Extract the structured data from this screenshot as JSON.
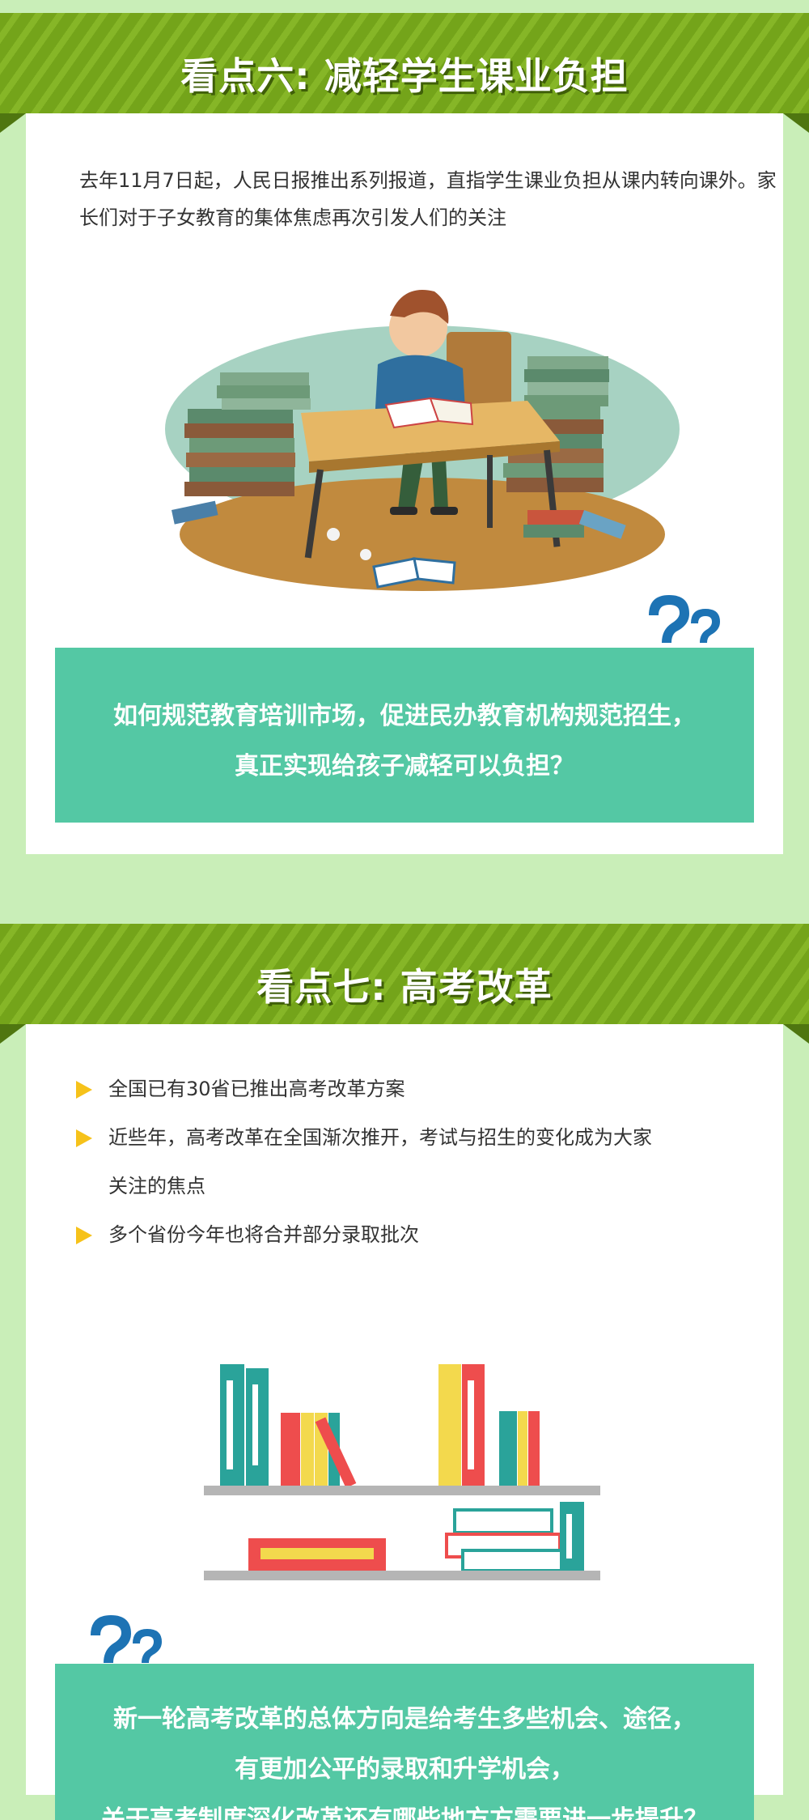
{
  "section6": {
    "title": "看点六: 减轻学生课业负担",
    "intro": "去年11月7日起，人民日报推出系列报道，直指学生课业负担从课内转向课外。家长们对于子女教育的集体焦虑再次引发人们的关注",
    "question_lines": [
      "如何规范教育培训市场，促进民办教育机构规范招生，",
      "真正实现给孩子减轻可以负担？"
    ]
  },
  "section7": {
    "title": "看点七: 高考改革",
    "bullets": [
      "全国已有30省已推出高考改革方案",
      "近些年，高考改革在全国渐次推开，考试与招生的变化成为大家",
      "关注的焦点",
      "多个省份今年也将合并部分录取批次"
    ],
    "question_lines": [
      "新一轮高考改革的总体方向是给考生多些机会、途径，",
      "有更加公平的录取和升学机会，",
      "关于高考制度深化改革还有哪些地方方需要进一步提升？"
    ]
  },
  "colors": {
    "background": "#c9eeb8",
    "banner": "#74a41a",
    "question_box": "#54c8a4",
    "bullet_arrow": "#f6c21a",
    "question_mark": "#1d73b4"
  }
}
